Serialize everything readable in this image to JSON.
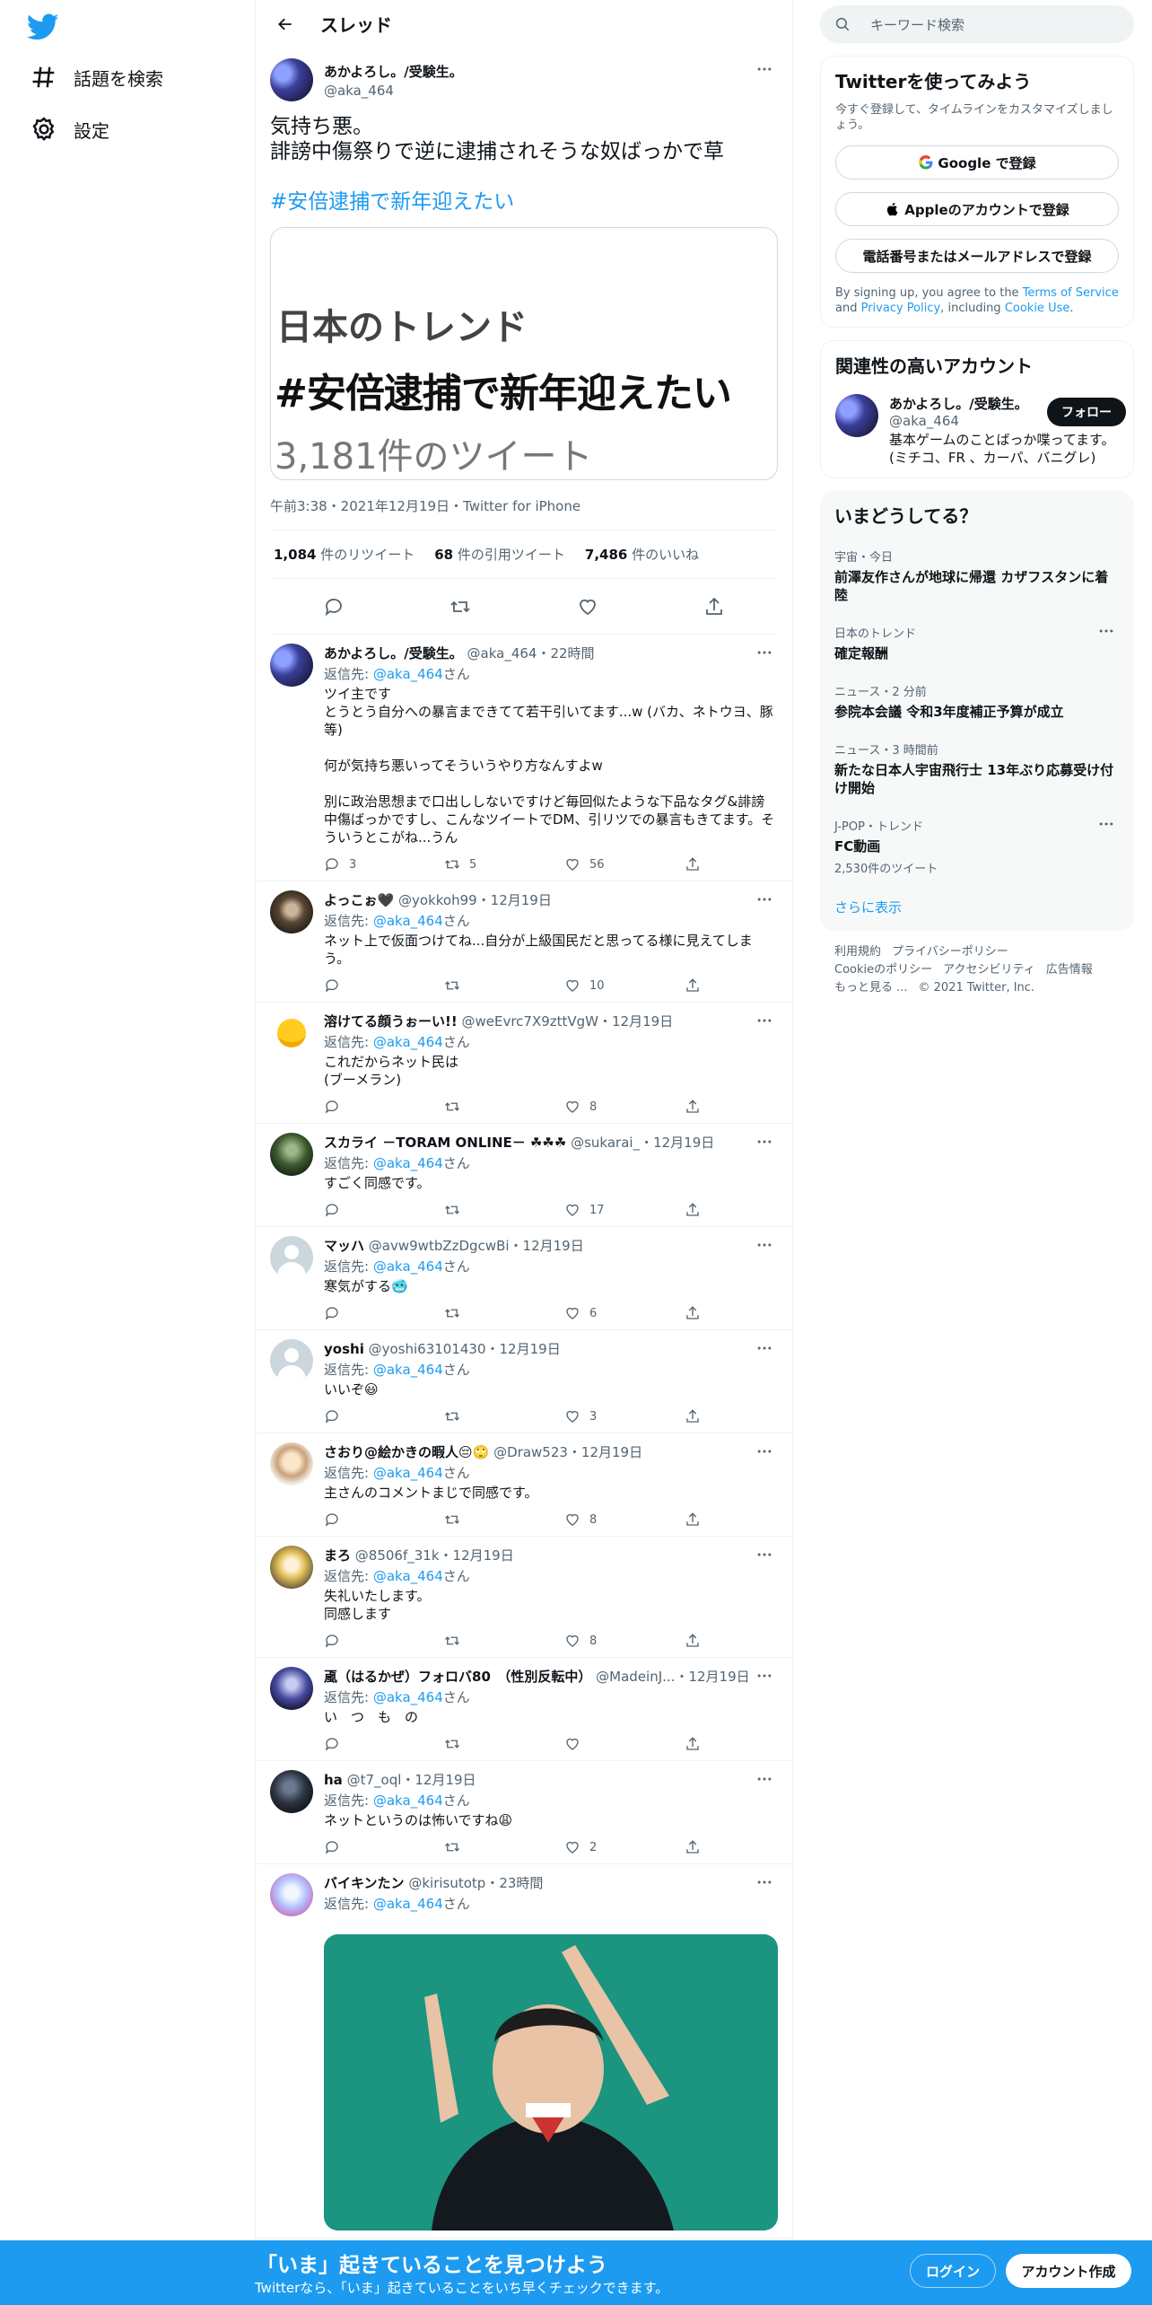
{
  "nav": {
    "items": [
      {
        "label": "話題を検索",
        "icon": "hashtag-icon"
      },
      {
        "label": "設定",
        "icon": "gear-icon"
      }
    ]
  },
  "header": {
    "title": "スレッド"
  },
  "main_tweet": {
    "name": "あかよろし。/受験生。",
    "handle": "@aka_464",
    "text": "気持ち悪。\n誹謗中傷祭りで逆に逮捕されそうな奴ばっかで草",
    "hashtag": "#安倍逮捕で新年迎えたい",
    "card": {
      "line1": "日本のトレンド",
      "line2": "#安倍逮捕で新年迎えたい",
      "line3": "3,181件のツイート"
    },
    "meta": "午前3:38・2021年12月19日・Twitter for iPhone",
    "retweets": "1,084",
    "retweets_label": "件のリツイート",
    "quotes": "68",
    "quotes_label": "件の引用ツイート",
    "likes": "7,486",
    "likes_label": "件のいいね"
  },
  "replies": [
    {
      "name": "あかよろし。/受験生。",
      "handle": "@aka_464・22時間",
      "to": "@aka_464",
      "text": "ツイ主です\nとうとう自分への暴言まできてて若干引いてます...w (バカ、ネトウヨ、豚等)\n\n何が気持ち悪いってそういうやり方なんすよw\n\n別に政治思想まで口出ししないですけど毎回似たような下品なタグ&誹謗中傷ばっかですし、こんなツイートでDM、引リツでの暴言もきてます。そういうとこがね...うん",
      "replies": "3",
      "rts": "5",
      "likes": "56",
      "avatar": "av-blue"
    },
    {
      "name": "よっこぉ🖤",
      "handle": "@yokkoh99・12月19日",
      "to": "@aka_464",
      "text": "ネット上で仮面つけてね...自分が上級国民だと思ってる様に見えてしまう。",
      "replies": "",
      "rts": "",
      "likes": "10",
      "avatar": "av-dark"
    },
    {
      "name": "溶けてる顔うぉーい!!",
      "handle": "@weEvrc7X9zttVgW・12月19日",
      "to": "@aka_464",
      "text": "これだからネット民は\n(ブーメラン)",
      "replies": "",
      "rts": "",
      "likes": "8",
      "avatar": "av-yellow"
    },
    {
      "name": "スカライ －TORAM ONLINE－ ☘☘☘",
      "handle": "@sukarai_・12月19日",
      "to": "@aka_464",
      "text": "すごく同感です。",
      "replies": "",
      "rts": "",
      "likes": "17",
      "avatar": "av-green"
    },
    {
      "name": "マッハ",
      "handle": "@avw9wtbZzDgcwBi・12月19日",
      "to": "@aka_464",
      "text": "寒気がする🥶",
      "replies": "",
      "rts": "",
      "likes": "6",
      "avatar": "av-def"
    },
    {
      "name": "yoshi",
      "handle": "@yoshi63101430・12月19日",
      "to": "@aka_464",
      "text": "いいぞ😃",
      "replies": "",
      "rts": "",
      "likes": "3",
      "avatar": "av-def"
    },
    {
      "name": "さおり@絵かきの暇人😔🙄",
      "handle": "@Draw523・12月19日",
      "to": "@aka_464",
      "text": "主さんのコメントまじで同感です。",
      "replies": "",
      "rts": "",
      "likes": "8",
      "avatar": "av-girl"
    },
    {
      "name": "まろ",
      "handle": "@8506f_31k・12月19日",
      "to": "@aka_464",
      "text": "失礼いたします。\n同感します",
      "replies": "",
      "rts": "",
      "likes": "8",
      "avatar": "av-anime"
    },
    {
      "name": "颪（はるかぜ）フォロバ80　（性別反転中）",
      "handle": "@MadeinJ...・12月19日",
      "to": "@aka_464",
      "text": "い　つ　も　の",
      "replies": "",
      "rts": "",
      "likes": "",
      "avatar": "av-robot"
    },
    {
      "name": "ha",
      "handle": "@t7_oql・12月19日",
      "to": "@aka_464",
      "text": "ネットというのは怖いですね😩",
      "replies": "",
      "rts": "",
      "likes": "2",
      "avatar": "av-night"
    },
    {
      "name": "バイキンたン",
      "handle": "@kirisutotp・23時間",
      "to": "@aka_464",
      "text": "",
      "replies": "",
      "rts": "",
      "likes": "",
      "avatar": "av-pink",
      "photo": true
    }
  ],
  "reply_prefix": "返信先: ",
  "reply_suffix": "さん",
  "search": {
    "placeholder": "キーワード検索"
  },
  "signup_box": {
    "title": "Twitterを使ってみよう",
    "subtitle": "今すぐ登録して、タイムラインをカスタマイズしましょう。",
    "google": "Google で登録",
    "apple": "Appleのアカウントで登録",
    "phone": "電話番号またはメールアドレスで登録",
    "legal_pre": "By signing up, you agree to the ",
    "tos": "Terms of Service",
    "and": " and ",
    "privacy": "Privacy Policy",
    "including": ", including ",
    "cookie": "Cookie Use",
    "end": "."
  },
  "related": {
    "title": "関連性の高いアカウント",
    "name": "あかよろし。/受験生。",
    "handle": "@aka_464",
    "bio": "基本ゲームのことばっか喋ってます。(ミチコ、FR 、カーパ、バニグレ)",
    "follow": "フォロー"
  },
  "trends": {
    "title": "いまどうしてる？",
    "items": [
      {
        "context": "宇宙・今日",
        "name": "前澤友作さんが地球に帰還 カザフスタンに着陸",
        "count": "",
        "more": false
      },
      {
        "context": "日本のトレンド",
        "name": "確定報酬",
        "count": "",
        "more": true
      },
      {
        "context": "ニュース・2 分前",
        "name": "参院本会議 令和3年度補正予算が成立",
        "count": "",
        "more": false
      },
      {
        "context": "ニュース・3 時間前",
        "name": "新たな日本人宇宙飛行士 13年ぶり応募受け付け開始",
        "count": "",
        "more": false
      },
      {
        "context": "J-POP・トレンド",
        "name": "FC動画",
        "count": "2,530件のツイート",
        "more": true
      }
    ],
    "show_more": "さらに表示"
  },
  "footer": {
    "line1": [
      "利用規約",
      "プライバシーポリシー"
    ],
    "line2": [
      "Cookieのポリシー",
      "アクセシビリティ",
      "広告情報"
    ],
    "line3": [
      "もっと見る ...",
      "© 2021 Twitter, Inc."
    ]
  },
  "banner": {
    "title": "「いま」起きていることを見つけよう",
    "subtitle": "Twitterなら、「いま」起きていることをいち早くチェックできます。",
    "login": "ログイン",
    "signup": "アカウント作成"
  }
}
